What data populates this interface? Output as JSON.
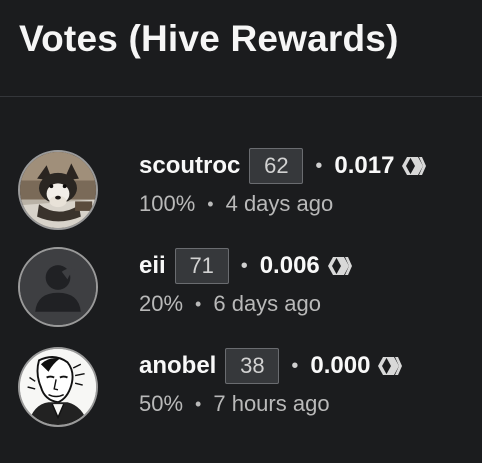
{
  "header": {
    "title": "Votes (Hive Rewards)"
  },
  "separator": "•",
  "votes": [
    {
      "username": "scoutroc",
      "reputation": "62",
      "payout": "0.017",
      "percent": "100%",
      "time": "4 days ago",
      "avatar_icon": "dog-photo-avatar"
    },
    {
      "username": "eii",
      "reputation": "71",
      "payout": "0.006",
      "percent": "20%",
      "time": "6 days ago",
      "avatar_icon": "default-user-avatar"
    },
    {
      "username": "anobel",
      "reputation": "38",
      "payout": "0.000",
      "percent": "50%",
      "time": "7 hours ago",
      "avatar_icon": "sketch-portrait-avatar"
    }
  ],
  "colors": {
    "background": "#1b1c1e",
    "text": "#f8f8f8",
    "muted_text": "#b9b9b9",
    "badge_bg": "#36383b",
    "badge_border": "#6a6c70"
  }
}
